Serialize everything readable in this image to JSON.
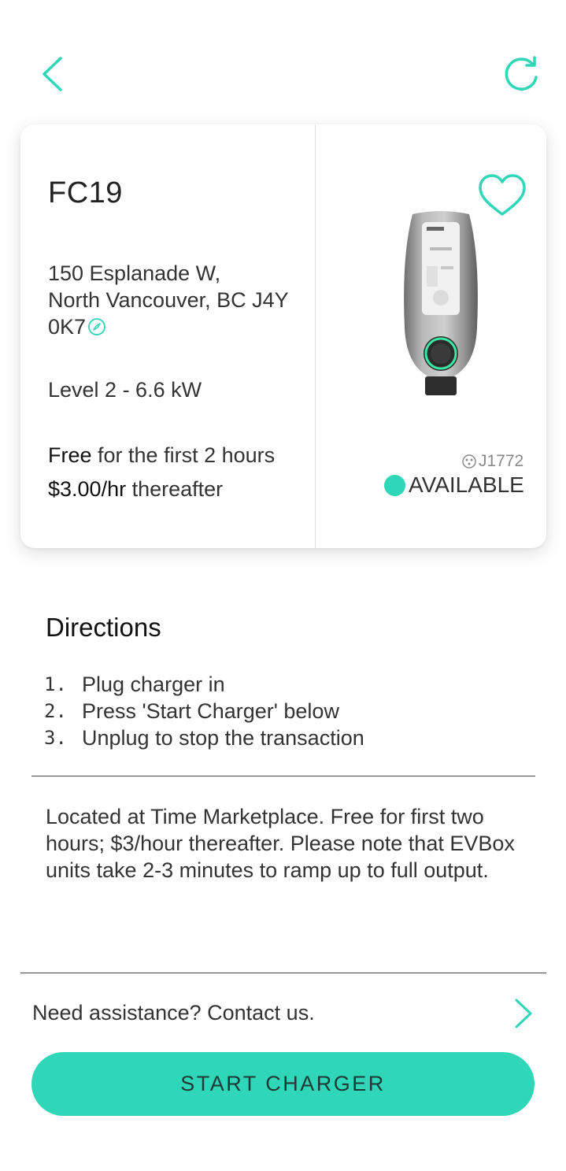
{
  "colors": {
    "accent": "#2fd6b8",
    "text": "#333333",
    "divider": "#444444"
  },
  "nav": {
    "back_icon": "chevron-left-icon",
    "refresh_icon": "refresh-icon"
  },
  "station": {
    "name": "FC19",
    "address_line1": "150 Esplanade W,",
    "address_line2": "North Vancouver, BC J4Y",
    "address_line3": "0K7",
    "level": "Level 2 - 6.6 kW",
    "price_free_bold": "Free",
    "price_free_rest": " for the first 2 hours",
    "price_rate_bold": "$3.00/hr",
    "price_rate_rest": " thereafter",
    "connector": "J1772",
    "status": "AVAILABLE",
    "favorite_icon": "heart-outline-icon"
  },
  "directions": {
    "title": "Directions",
    "steps": [
      {
        "num": "1.",
        "text": "Plug charger in"
      },
      {
        "num": "2.",
        "text": "Press 'Start Charger' below"
      },
      {
        "num": "3.",
        "text": "Unplug to stop the transaction"
      }
    ]
  },
  "notes": "Located at Time Marketplace. Free for first two hours; $3/hour thereafter. Please note that EVBox units take 2-3 minutes to ramp up to full output.",
  "assistance": {
    "label": "Need assistance? Contact us."
  },
  "start_button": {
    "label": "START CHARGER"
  }
}
